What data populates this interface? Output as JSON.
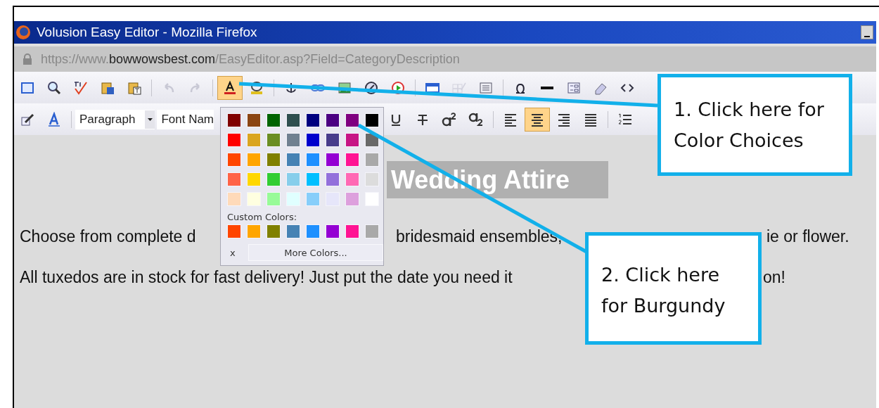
{
  "window": {
    "title": "Volusion Easy Editor - Mozilla Firefox"
  },
  "address_bar": {
    "scheme": "https://www.",
    "domain": "bowwowsbest.com",
    "path": "/EasyEditor.asp?Field=CategoryDescription"
  },
  "toolbars": [
    {
      "items": [
        {
          "kind": "fullscreen",
          "active": false,
          "disabled": false
        },
        {
          "kind": "preview",
          "active": false,
          "disabled": false
        },
        {
          "kind": "spellcheck",
          "active": false,
          "disabled": false
        },
        {
          "kind": "pasteword",
          "active": false,
          "disabled": false
        },
        {
          "kind": "pastetext",
          "active": false,
          "disabled": false
        },
        {
          "kind": "separator"
        },
        {
          "kind": "undo",
          "active": false,
          "disabled": true
        },
        {
          "kind": "redo",
          "active": false,
          "disabled": true
        },
        {
          "kind": "separator"
        },
        {
          "kind": "fontcolor",
          "active": true,
          "disabled": false
        },
        {
          "kind": "highlight",
          "active": false,
          "disabled": false
        },
        {
          "kind": "separator"
        },
        {
          "kind": "anchor",
          "active": false,
          "disabled": false
        },
        {
          "kind": "link",
          "active": false,
          "disabled": false
        },
        {
          "kind": "image",
          "active": false,
          "disabled": false
        },
        {
          "kind": "flash",
          "active": false,
          "disabled": false
        },
        {
          "kind": "media",
          "active": false,
          "disabled": false
        },
        {
          "kind": "separator"
        },
        {
          "kind": "table",
          "active": false,
          "disabled": false
        },
        {
          "kind": "tableedit",
          "active": false,
          "disabled": true
        },
        {
          "kind": "div",
          "active": false,
          "disabled": false
        },
        {
          "kind": "separator"
        },
        {
          "kind": "symbol",
          "active": false,
          "disabled": false
        },
        {
          "kind": "rule",
          "active": false,
          "disabled": false
        },
        {
          "kind": "form",
          "active": false,
          "disabled": false
        },
        {
          "kind": "eraser",
          "active": false,
          "disabled": false
        },
        {
          "kind": "source",
          "active": false,
          "disabled": false
        }
      ]
    },
    {
      "items": [
        {
          "kind": "edit",
          "active": false,
          "disabled": false
        },
        {
          "kind": "styles",
          "active": false,
          "disabled": false
        },
        {
          "kind": "separator"
        },
        {
          "kind": "dropdown",
          "value": "Paragraph"
        },
        {
          "kind": "dropdown",
          "value": "Font Nam"
        },
        {
          "kind": "underline",
          "active": false,
          "disabled": false
        },
        {
          "kind": "strike",
          "active": false,
          "disabled": false
        },
        {
          "kind": "superscript",
          "active": false,
          "disabled": false
        },
        {
          "kind": "subscript",
          "active": false,
          "disabled": false
        },
        {
          "kind": "separator"
        },
        {
          "kind": "alignleft",
          "active": false,
          "disabled": false
        },
        {
          "kind": "aligncenter",
          "active": true,
          "disabled": false
        },
        {
          "kind": "alignright",
          "active": false,
          "disabled": false
        },
        {
          "kind": "justify",
          "active": false,
          "disabled": false
        },
        {
          "kind": "separator"
        },
        {
          "kind": "numbered",
          "active": false,
          "disabled": false
        }
      ]
    }
  ],
  "content": {
    "heading": "Wedding Attire",
    "paragraphs": [
      {
        "segments": [
          "Choose from complete d",
          "bridesmaid ensembles,",
          "ie or flower."
        ]
      },
      {
        "segments": [
          "All tuxedos are in stock for fast delivery! Just put the date you need it",
          "on!"
        ]
      }
    ]
  },
  "color_popup": {
    "rows": [
      {
        "swatches": [
          {
            "color": "#800000"
          },
          {
            "color": "#8b4513"
          },
          {
            "color": "#006400"
          },
          {
            "color": "#2f4f4f"
          },
          {
            "color": "#000080"
          },
          {
            "color": "#4b0082"
          },
          {
            "color": "#800080"
          },
          {
            "color": "#000000"
          }
        ]
      },
      {
        "swatches": [
          {
            "color": "#ff0000"
          },
          {
            "color": "#daa520"
          },
          {
            "color": "#6b8e23"
          },
          {
            "color": "#708090"
          },
          {
            "color": "#0000cd"
          },
          {
            "color": "#483d8b"
          },
          {
            "color": "#c71585"
          },
          {
            "color": "#696969"
          }
        ]
      },
      {
        "swatches": [
          {
            "color": "#ff4500"
          },
          {
            "color": "#ffa500"
          },
          {
            "color": "#808000"
          },
          {
            "color": "#4682b4"
          },
          {
            "color": "#1e90ff"
          },
          {
            "color": "#9400d3"
          },
          {
            "color": "#ff1493"
          },
          {
            "color": "#a9a9a9"
          }
        ]
      },
      {
        "swatches": [
          {
            "color": "#ff6347"
          },
          {
            "color": "#ffd700"
          },
          {
            "color": "#32cd32"
          },
          {
            "color": "#87ceeb"
          },
          {
            "color": "#00bfff"
          },
          {
            "color": "#9370db"
          },
          {
            "color": "#ff69b4"
          },
          {
            "color": "#dcdcdc"
          }
        ]
      },
      {
        "swatches": [
          {
            "color": "#ffdab9"
          },
          {
            "color": "#ffffe0"
          },
          {
            "color": "#98fb98"
          },
          {
            "color": "#e0ffff"
          },
          {
            "color": "#87cefa"
          },
          {
            "color": "#e6e6fa"
          },
          {
            "color": "#dda0dd"
          },
          {
            "color": "#ffffff"
          }
        ]
      }
    ],
    "custom_label": "Custom Colors:",
    "custom": [
      {
        "color": "#ff4500"
      },
      {
        "color": "#ffa500"
      },
      {
        "color": "#808000"
      },
      {
        "color": "#4682b4"
      },
      {
        "color": "#1e90ff"
      },
      {
        "color": "#9400d3"
      },
      {
        "color": "#ff1493"
      },
      {
        "color": "#a9a9a9"
      }
    ],
    "close": "x",
    "more_button": "More Colors..."
  },
  "callouts": [
    {
      "lines": [
        "1. Click here for",
        "Color Choices"
      ]
    },
    {
      "lines": [
        "2. Click here",
        "for Burgundy"
      ]
    }
  ]
}
